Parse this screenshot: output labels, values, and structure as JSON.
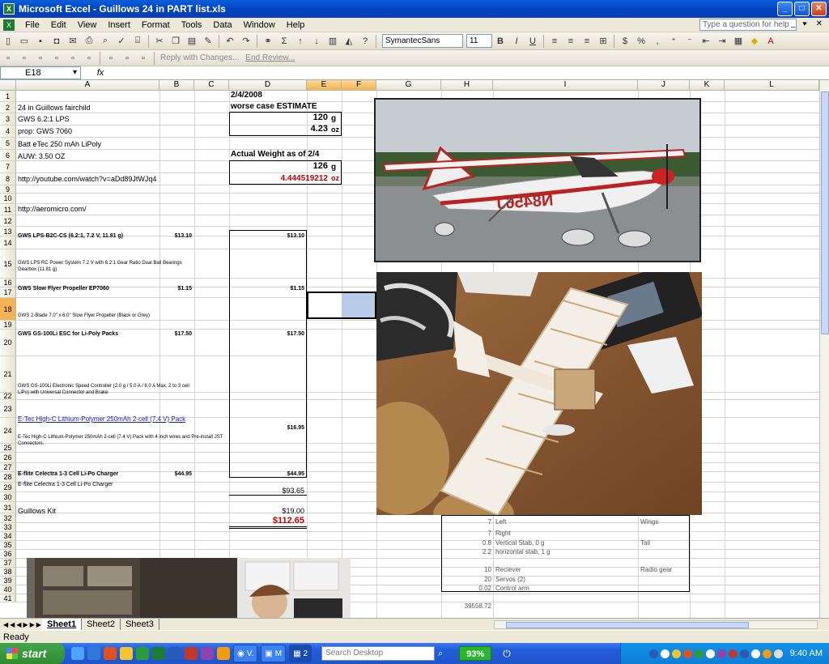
{
  "window": {
    "title": "Microsoft Excel - Guillows 24 in PART list.xls",
    "minimize": "_",
    "maximize": "□",
    "close": "✕"
  },
  "menu": {
    "items": [
      "File",
      "Edit",
      "View",
      "Insert",
      "Format",
      "Tools",
      "Data",
      "Window",
      "Help"
    ],
    "help_placeholder": "Type a question for help"
  },
  "toolbar": {
    "font_name": "SymantecSans",
    "font_size": "11",
    "reply_label": "Reply with Changes...",
    "end_review_label": "End Review...",
    "bold": "B",
    "italic": "I",
    "underline": "U",
    "currency": "$",
    "percent": "%",
    "sigma": "Σ"
  },
  "formula": {
    "cell_ref": "E18",
    "fx": "fx",
    "content": ""
  },
  "columns": [
    "A",
    "B",
    "C",
    "D",
    "E",
    "F",
    "G",
    "H",
    "I",
    "J",
    "K",
    "L"
  ],
  "rows": [
    "1",
    "2",
    "3",
    "4",
    "5",
    "6",
    "7",
    "8",
    "9",
    "10",
    "11",
    "12",
    "13",
    "14",
    "15",
    "16",
    "17",
    "18",
    "19",
    "20",
    "21",
    "22",
    "23",
    "24",
    "25",
    "26",
    "27",
    "28",
    "29",
    "30",
    "31",
    "32",
    "33",
    "34",
    "35",
    "36",
    "37",
    "38",
    "39",
    "40",
    "41"
  ],
  "cells": {
    "a2": "24 in Guillows fairchild",
    "a3": "GWS 6.2:1 LPS",
    "a4": "prop: GWS 7060",
    "a5": "Batt eTec 250 mAh LiPoly",
    "a6": "AUW: 3.50 OZ",
    "a8": "http://youtube.com/watch?v=aDd89JtWJq4",
    "a11": "http://aeromicro.com/",
    "a14": "GWS LPS-B2C-CS (6.2:1, 7.2 V, 11.81 g)",
    "b14": "$13.10",
    "d14": "$13.10",
    "a15": "GWS LPS RC Power System 7.2 V with 6.2:1 Gear Ratio Dual Ball Bearings Gearbox (11.81 g)",
    "a17": "GWS Slow Flyer Propeller EP7060",
    "b17": "$1.15",
    "d17": "$1.15",
    "a18": "GWS 2-Blade 7.0\" x 6.0\" Slow Flyer Propeller (Black or Grey)",
    "a20": "GWS GS-100Li ESC for Li-Poly Packs",
    "b20": "$17.50",
    "d20": "$17.50",
    "a21": "GWS GS-100Li Electronic Speed Controller (2.0 g / 5.0 A / 8.0 A Max, 2 to 3 cell LiPo) with Universal Connector and Brake",
    "a23": "E-Tec High-C Lithium-Polymer 250mAh 2-cell (7.4 V) Pack",
    "d23": "$16.95",
    "a24": "E-Tec High-C Lithium-Polymer 250mAh 2-cell (7.4 V) Pack with 4 inch wires and Pre-install JST Connectors.",
    "a26": "E-flite Celectra 1-3 Cell Li-Po Charger",
    "b26": "$44.95",
    "d26": "$44.95",
    "a27": "E-flite Celectra 1-3 Cell Li-Po Charger",
    "d28": "$93.65",
    "a30": "Guillows Kit",
    "d30": "$19.00",
    "d31": "$112.65",
    "d1": "2/4/2008",
    "d2": "worse case ESTIMATE",
    "d3": "120",
    "d3u": "g",
    "d4": "4.23",
    "d4u": "oz",
    "d6": "Actual Weight as of 2/4",
    "d7": "126",
    "d7u": "g",
    "d8": "4.444519212",
    "d8u": "oz",
    "h31": "7",
    "i31": "Left",
    "j31": "Wings",
    "h32": "7",
    "i32": "Right",
    "h33": "0.8",
    "i33": "Vertical Stab, 0 g",
    "j33": "Tail",
    "h34": "2.2",
    "i34": "horizontal stab, 1 g",
    "h36": "10",
    "i36": "Reciever",
    "j36": "Radio gear",
    "h37": "20",
    "i37": "Servos (2)",
    "h38": "0.02",
    "i38": "Control arm",
    "h40": "39558.72"
  },
  "photo_text": {
    "tail_number": "N8456J"
  },
  "sheets": [
    "Sheet1",
    "Sheet2",
    "Sheet3"
  ],
  "status": "Ready",
  "taskbar": {
    "start": "start",
    "search_placeholder": "Search Desktop",
    "battery": "93%",
    "clock": "9:40 AM",
    "task_v": "V.",
    "task_m": "M",
    "task_2": "2"
  }
}
